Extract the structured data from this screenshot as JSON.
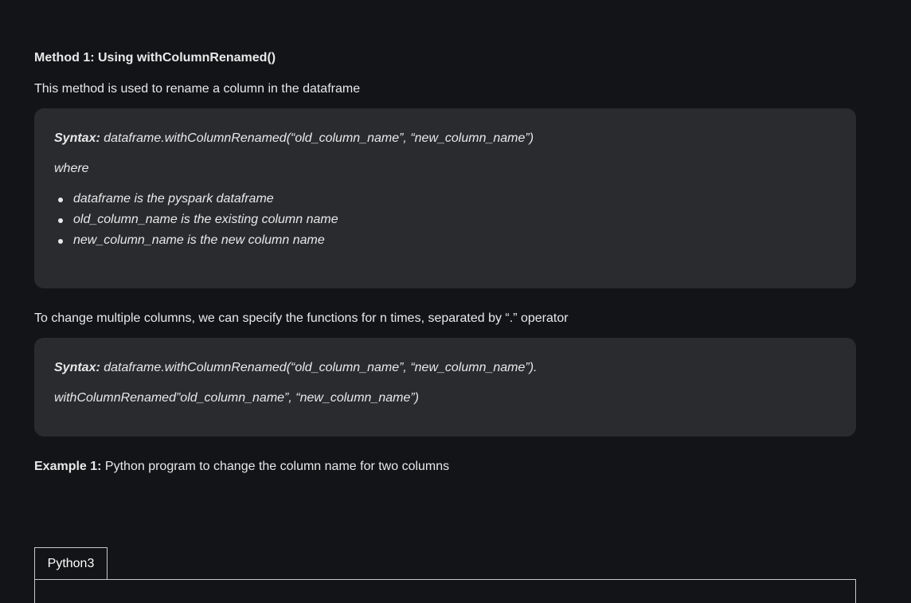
{
  "method1": {
    "heading": "Method 1: Using withColumnRenamed()",
    "description": "This method is used to rename a column in the dataframe",
    "syntax_box": {
      "syntax_label": "Syntax:",
      "syntax_code": " dataframe.withColumnRenamed(“old_column_name”, “new_column_name”)",
      "where": "where",
      "bullets": [
        "dataframe is the pyspark dataframe",
        "old_column_name is the existing column name",
        "new_column_name is the new column name"
      ]
    }
  },
  "multiple": {
    "description": "To change multiple columns, we can specify the functions for n times, separated by “.” operator",
    "syntax_box": {
      "syntax_label": "Syntax:",
      "syntax_code_line1": " dataframe.withColumnRenamed(“old_column_name”, “new_column_name”).",
      "syntax_code_line2": "withColumnRenamed”old_column_name”, “new_column_name”)"
    }
  },
  "example1": {
    "label": "Example 1:",
    "text": " Python program to change the column name for two columns"
  },
  "code_tabs": [
    {
      "label": "Python3",
      "active": true
    }
  ]
}
